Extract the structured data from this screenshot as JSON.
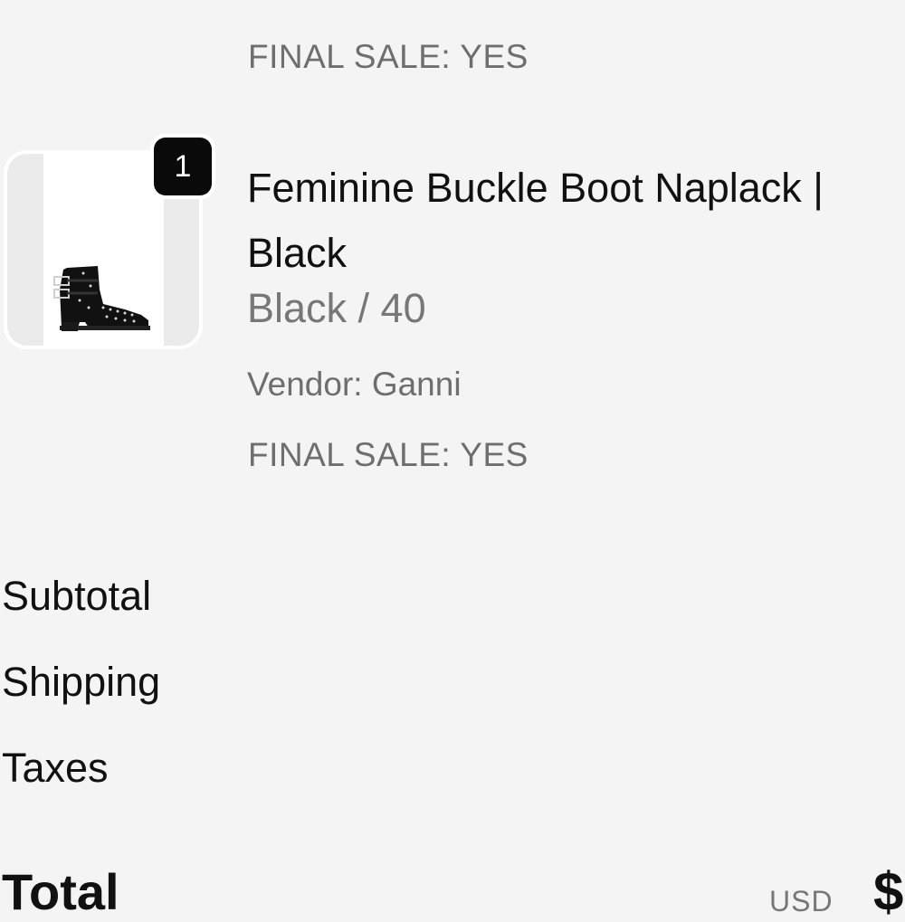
{
  "line_items": [
    {
      "final_sale": "FINAL SALE: YES"
    },
    {
      "quantity": "1",
      "name": "Feminine Buckle Boot Naplack | Black",
      "variant": "Black / 40",
      "vendor": "Vendor: Ganni",
      "final_sale": "FINAL SALE: YES",
      "thumbnail_icon": "ankle-boot-image"
    }
  ],
  "summary": {
    "subtotal_label": "Subtotal",
    "shipping_label": "Shipping",
    "taxes_label": "Taxes",
    "total_label": "Total",
    "currency": "USD",
    "total_amount": "$"
  },
  "colors": {
    "background": "#f4f4f4",
    "badge": "#0a0a0a",
    "muted_text": "#6e6e6e"
  }
}
